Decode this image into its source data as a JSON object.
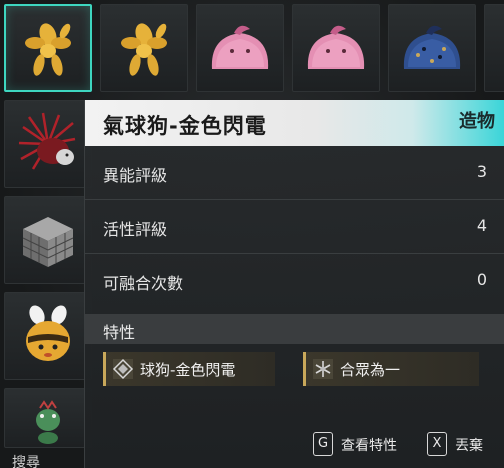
{
  "inventory": {
    "slots": [
      {
        "name": "balloon-dog-gold"
      },
      {
        "name": "balloon-dog-gold-2"
      },
      {
        "name": "pink-blob-1"
      },
      {
        "name": "pink-blob-2"
      },
      {
        "name": "blue-blob"
      },
      {
        "name": "red-hedgehog"
      },
      {
        "name": "metal-cube"
      },
      {
        "name": "bee-plush"
      },
      {
        "name": "green-creature"
      }
    ],
    "search_label": "搜尋"
  },
  "tooltip": {
    "title": "氣球狗-金色閃電",
    "tag": "造物",
    "stats": [
      {
        "label": "異能評級",
        "value": "3"
      },
      {
        "label": "活性評級",
        "value": "4"
      },
      {
        "label": "可融合次數",
        "value": "0"
      }
    ],
    "traits_heading": "特性",
    "traits": [
      {
        "label": "球狗-金色閃電",
        "icon": "diamond-icon"
      },
      {
        "label": "合眾為一",
        "icon": "snowflake-icon"
      }
    ],
    "hints": [
      {
        "key": "G",
        "label": "查看特性"
      },
      {
        "key": "X",
        "label": "丟棄"
      }
    ]
  },
  "colors": {
    "accent": "#3ed6c0",
    "header_cyan": "#39d5d8",
    "trait_gold": "#c9a85a"
  }
}
